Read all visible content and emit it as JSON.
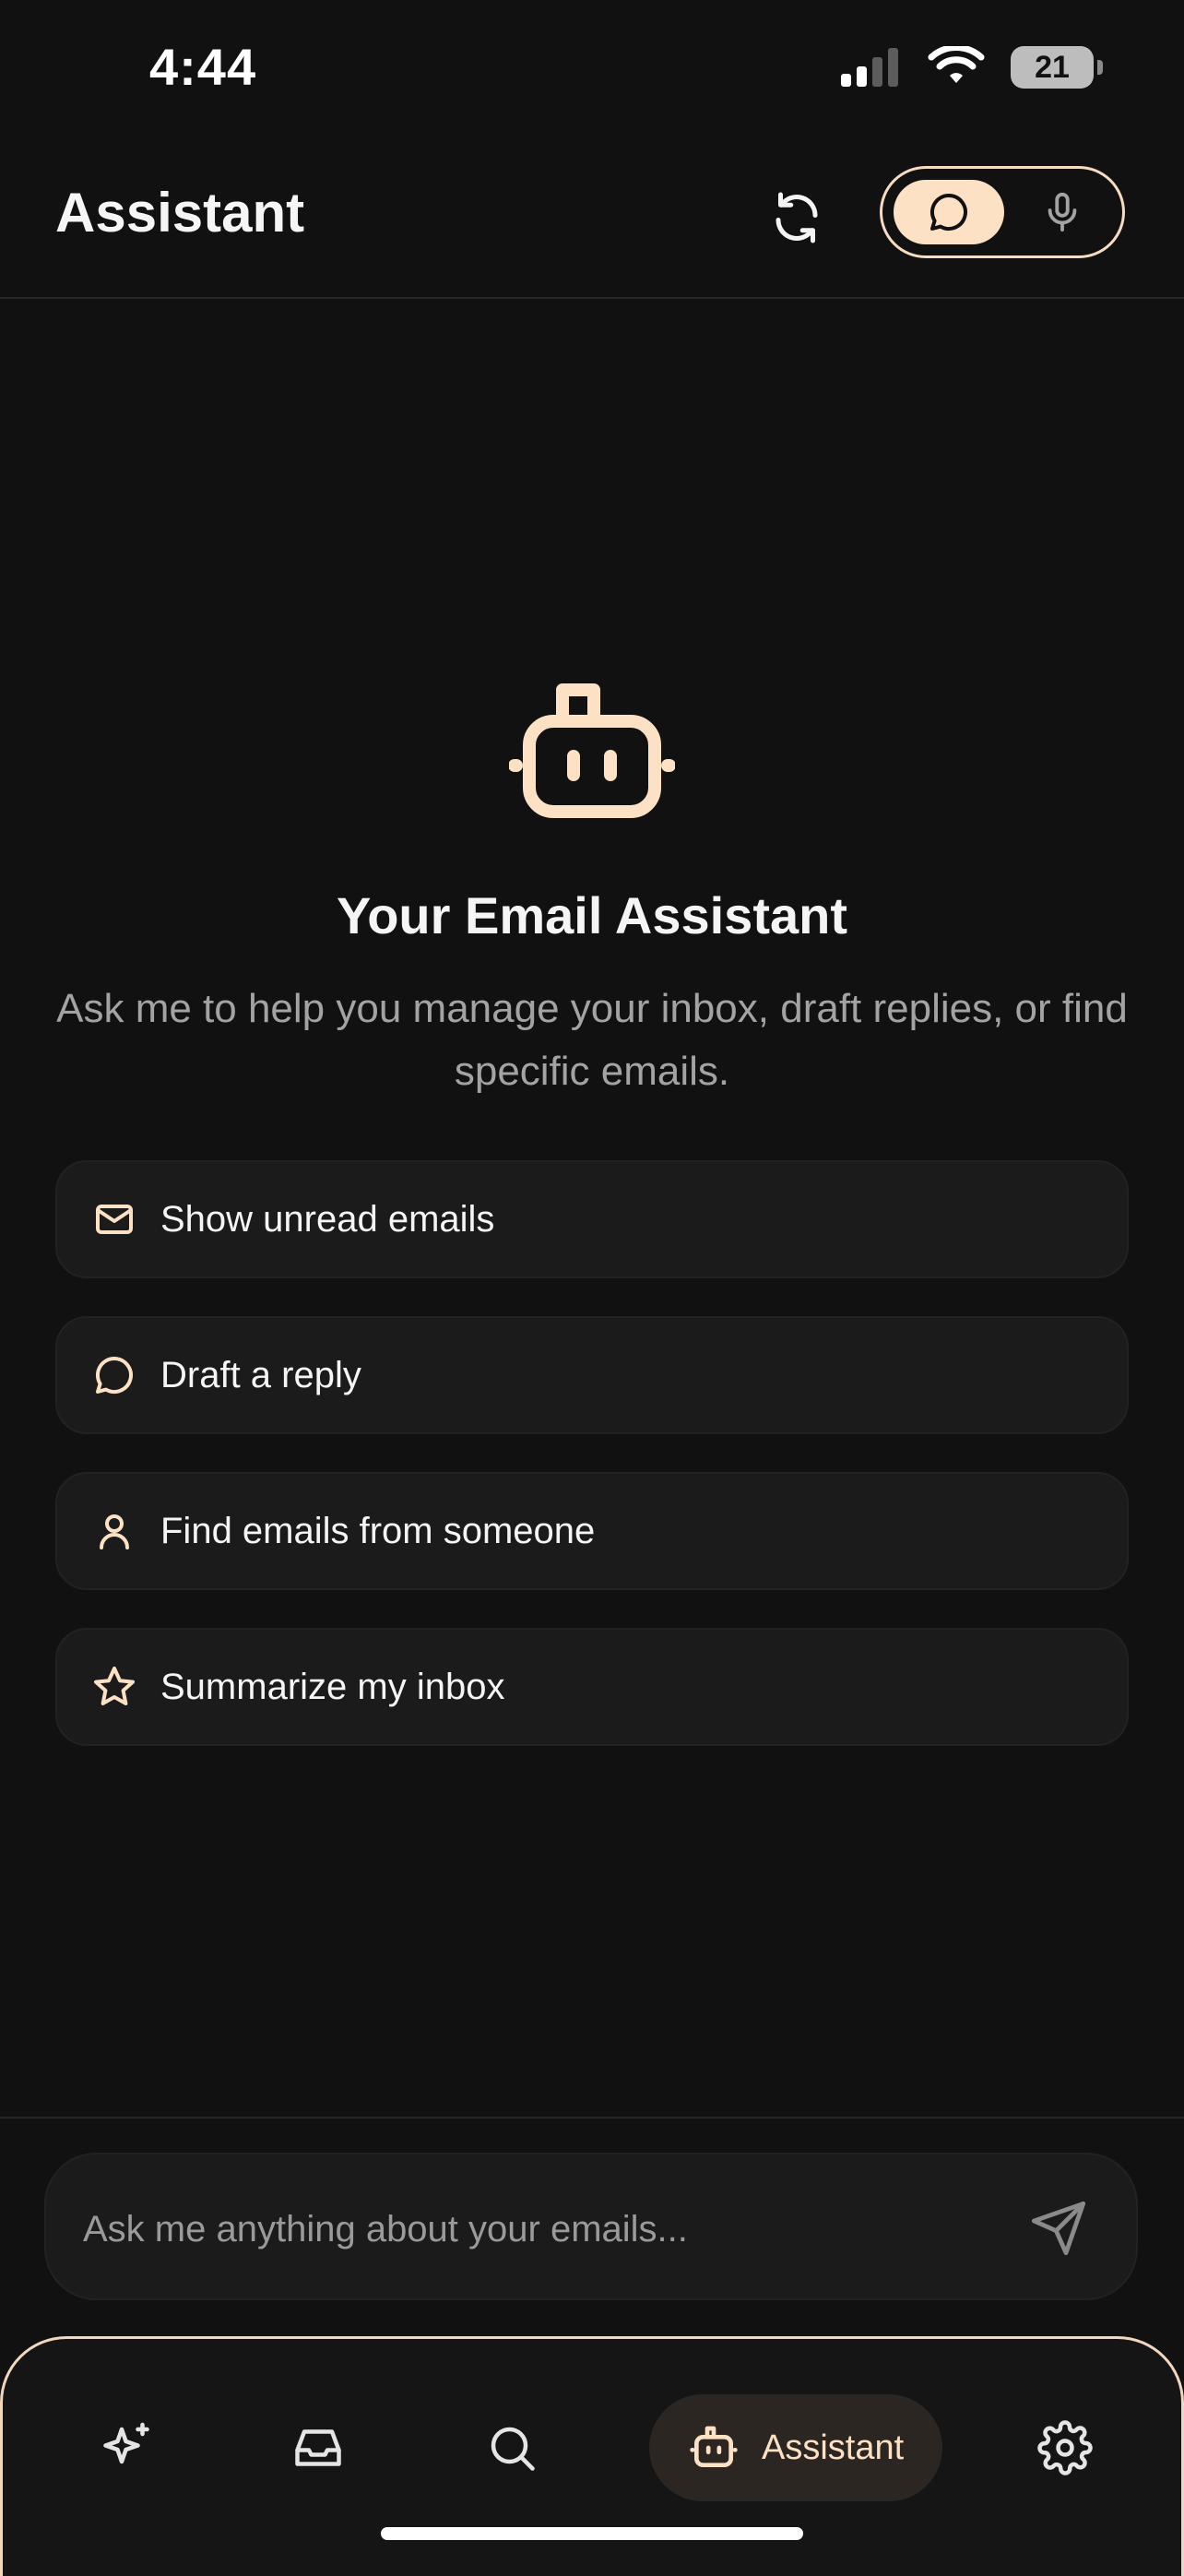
{
  "status_bar": {
    "time": "4:44",
    "battery": "21"
  },
  "header": {
    "title": "Assistant"
  },
  "hero": {
    "title": "Your Email Assistant",
    "subtitle": "Ask me to help you manage your inbox, draft replies, or find specific emails."
  },
  "suggestions": [
    {
      "icon": "mail-icon",
      "label": "Show unread emails"
    },
    {
      "icon": "chat-bubble-icon",
      "label": "Draft a reply"
    },
    {
      "icon": "person-icon",
      "label": "Find emails from someone"
    },
    {
      "icon": "star-icon",
      "label": "Summarize my inbox"
    }
  ],
  "composer": {
    "placeholder": "Ask me anything about your emails..."
  },
  "tabbar": {
    "tabs": [
      {
        "icon": "sparkles-icon",
        "label": ""
      },
      {
        "icon": "inbox-icon",
        "label": ""
      },
      {
        "icon": "search-icon",
        "label": ""
      },
      {
        "icon": "robot-icon",
        "label": "Assistant",
        "active": true
      },
      {
        "icon": "gear-icon",
        "label": ""
      }
    ]
  },
  "colors": {
    "background": "#111111",
    "accent": "#fde1c5",
    "card": "#1b1b1b",
    "muted_text": "#a3a3a3"
  }
}
